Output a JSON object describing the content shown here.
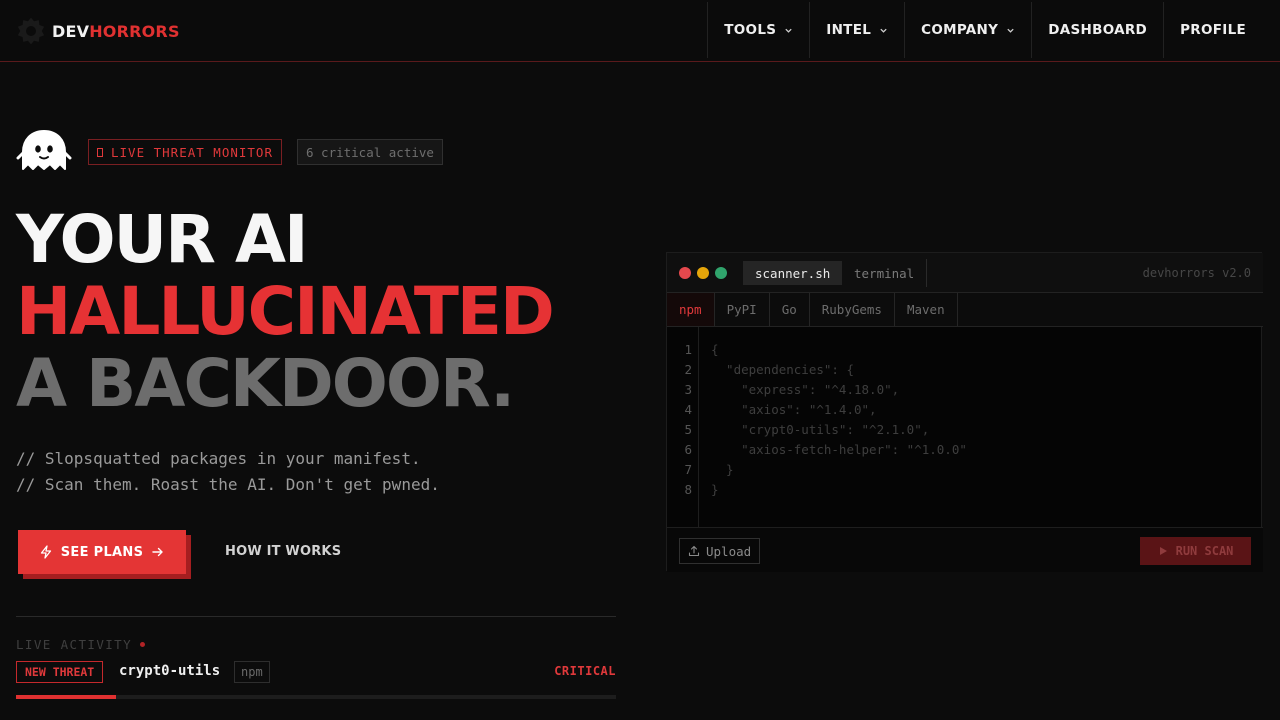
{
  "brand": {
    "name_dev": "DEV",
    "name_horrors": "HORRORS",
    "logo_icon": "bug-icon"
  },
  "nav": {
    "items": [
      {
        "label": "TOOLS",
        "has_dropdown": true
      },
      {
        "label": "INTEL",
        "has_dropdown": true
      },
      {
        "label": "COMPANY",
        "has_dropdown": true
      },
      {
        "label": "DASHBOARD",
        "has_dropdown": false
      },
      {
        "label": "PROFILE",
        "has_dropdown": false
      }
    ]
  },
  "hero": {
    "mascot_icon": "ghost-icon",
    "live_badge": "LIVE THREAT MONITOR",
    "critical_badge": "6 critical active",
    "headline": {
      "line1": "YOUR AI",
      "line2": "HALLUCINATED",
      "line3": "A BACKDOOR."
    },
    "tagline": [
      "// Slopsquatted packages in your manifest.",
      "// Scan them. Roast the AI. Don't get pwned."
    ],
    "cta_primary": "SEE PLANS",
    "cta_secondary": "HOW IT WORKS"
  },
  "activity": {
    "label": "LIVE ACTIVITY",
    "tag": "NEW THREAT",
    "package": "crypt0-utils",
    "ecosystem": "npm",
    "severity": "CRITICAL",
    "progress_fraction": 0.167
  },
  "terminal": {
    "tab_active": "scanner.sh",
    "tab_inactive": "terminal",
    "version": "devhorrors v2.0",
    "ecosystems": [
      "npm",
      "PyPI",
      "Go",
      "RubyGems",
      "Maven"
    ],
    "active_ecosystem": "npm",
    "line_numbers": [
      "1",
      "2",
      "3",
      "4",
      "5",
      "6",
      "7",
      "8"
    ],
    "code_lines": [
      "{",
      "  \"dependencies\": {",
      "    \"express\": \"^4.18.0\",",
      "    \"axios\": \"^1.4.0\",",
      "    \"crypt0-utils\": \"^2.1.0\",",
      "    \"axios-fetch-helper\": \"^1.0.0\"",
      "  }",
      "}"
    ],
    "upload_label": "Upload",
    "run_label": "RUN SCAN"
  },
  "colors": {
    "accent": "#e43535",
    "background": "#0c0c0c",
    "window_red": "#e5484d",
    "window_yellow": "#e5a50a",
    "window_green": "#30a46c"
  }
}
